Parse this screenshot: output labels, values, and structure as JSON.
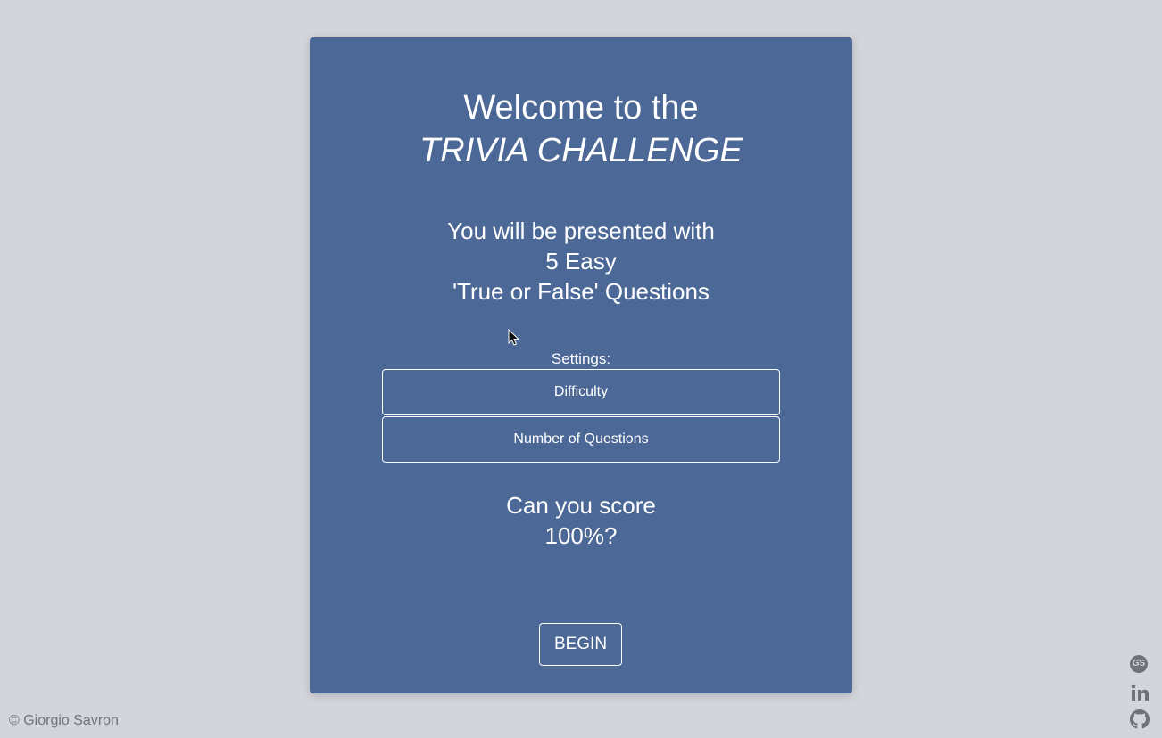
{
  "card": {
    "title_line1": "Welcome to the",
    "title_line2": "TRIVIA CHALLENGE",
    "intro_line1": "You will be presented with",
    "intro_line2": "5 Easy",
    "intro_line3": "'True or False' Questions",
    "settings_label": "Settings:",
    "difficulty_label": "Difficulty",
    "questions_label": "Number of Questions",
    "score_line1": "Can you score",
    "score_line2": "100%?",
    "begin_label": "BEGIN"
  },
  "footer": {
    "copyright": "© Giorgio Savron"
  },
  "social": {
    "gs_badge": "GS",
    "icons": [
      "gs-logo-icon",
      "linkedin-icon",
      "github-icon"
    ]
  },
  "colors": {
    "background": "#d3d5db",
    "card": "#4c6897",
    "text": "#ffffff",
    "footer_text": "#707378"
  }
}
